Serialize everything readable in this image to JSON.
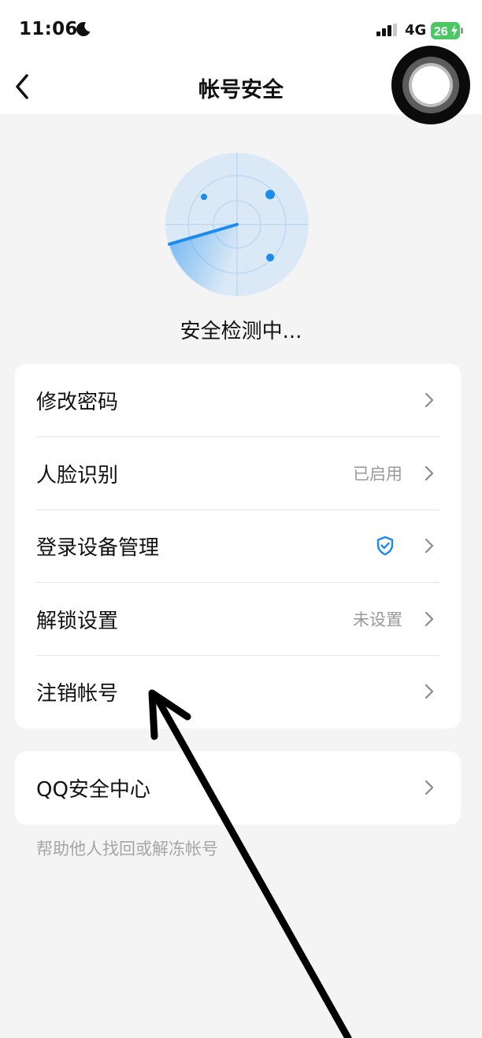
{
  "status_bar": {
    "time": "11:06",
    "network": "4G",
    "battery": "26",
    "icons": [
      "moon-icon",
      "signal-icon",
      "battery-charging-icon"
    ]
  },
  "header": {
    "title": "帐号安全",
    "back_icon": "chevron-left-icon"
  },
  "scan": {
    "status_text": "安全检测中..."
  },
  "security_menu": {
    "items": [
      {
        "label": "修改密码",
        "value": ""
      },
      {
        "label": "人脸识别",
        "value": "已启用"
      },
      {
        "label": "登录设备管理",
        "value": "",
        "icon": "shield-check-icon"
      },
      {
        "label": "解锁设置",
        "value": "未设置"
      },
      {
        "label": "注销帐号",
        "value": ""
      }
    ]
  },
  "qq_center": {
    "label": "QQ安全中心",
    "footnote": "帮助他人找回或解冻帐号"
  },
  "colors": {
    "accent": "#1a8cf0",
    "radar_bg": "#dbe9f6",
    "page_bg": "#f4f4f4",
    "secondary_text": "#9a9a9a"
  }
}
